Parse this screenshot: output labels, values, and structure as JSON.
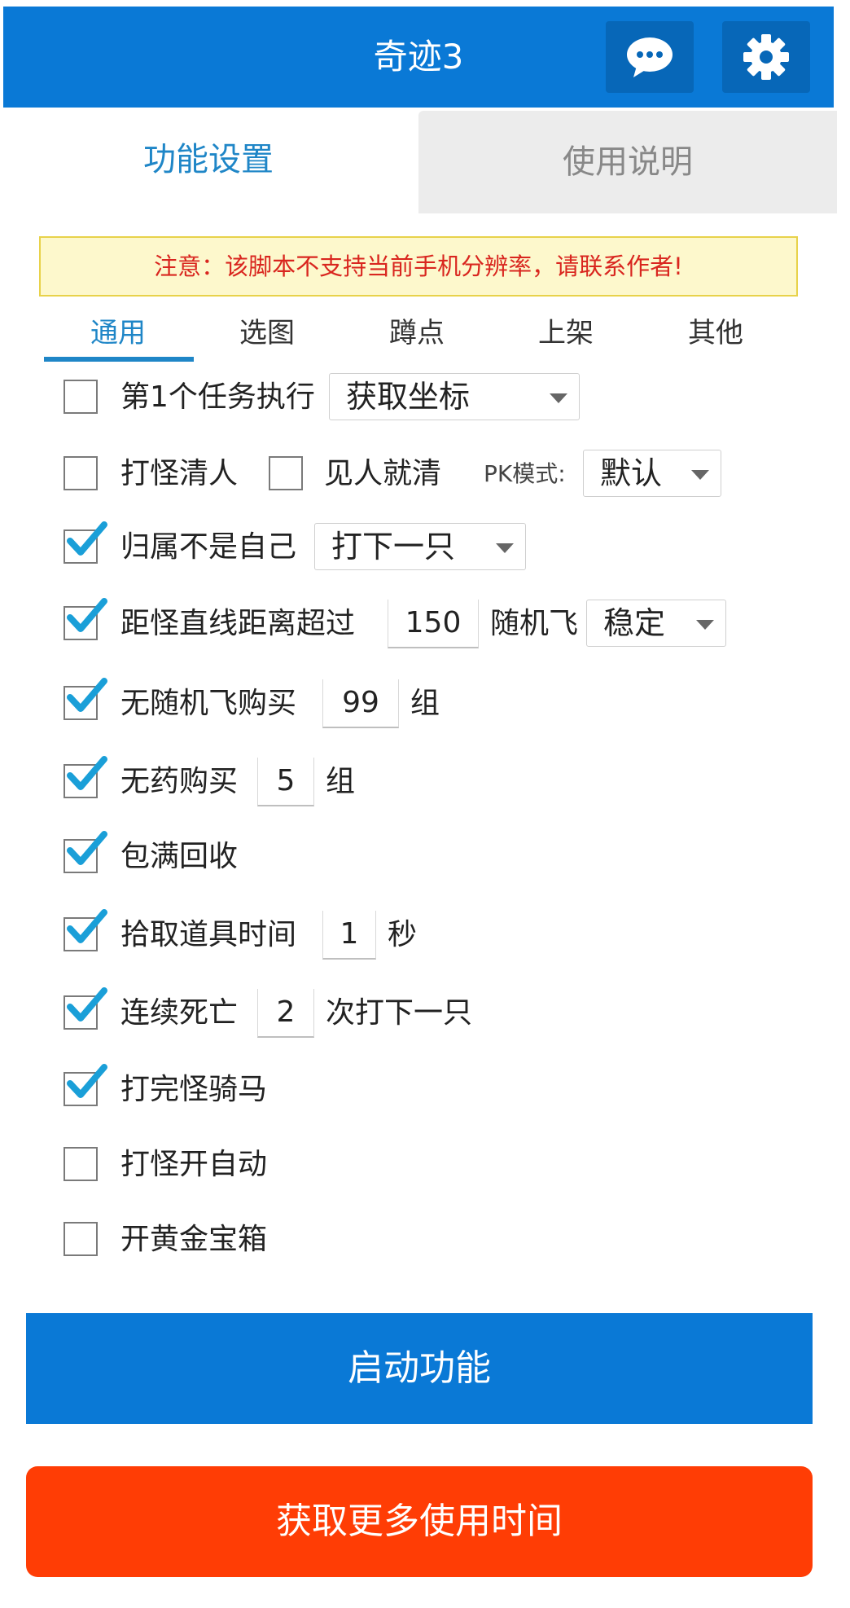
{
  "colors": {
    "primary": "#0a79d6",
    "accent_orange": "#ff3d05",
    "check": "#1a9fd8",
    "warning_text": "#d9261f"
  },
  "header": {
    "title": "奇迹3",
    "icons": [
      "chat-bubble-icon",
      "gear-icon"
    ]
  },
  "tabs": [
    {
      "label": "功能设置",
      "active": true
    },
    {
      "label": "使用说明",
      "active": false
    }
  ],
  "notice": "注意：该脚本不支持当前手机分辨率，请联系作者!",
  "subtabs": [
    {
      "label": "通用",
      "active": true
    },
    {
      "label": "选图"
    },
    {
      "label": "蹲点"
    },
    {
      "label": "上架"
    },
    {
      "label": "其他"
    }
  ],
  "rows": {
    "task": {
      "checked": false,
      "label": "第1个任务执行",
      "select": "获取坐标"
    },
    "clear": {
      "checked": false,
      "label": "打怪清人",
      "cb2_checked": false,
      "label2": "见人就清",
      "pk_label": "PK模式:",
      "pk_select": "默认"
    },
    "owner": {
      "checked": true,
      "label": "归属不是自己",
      "select": "打下一只"
    },
    "distance": {
      "checked": true,
      "label": "距怪直线距离超过",
      "value": "150",
      "label2": "随机飞",
      "select": "稳定"
    },
    "buy_fly": {
      "checked": true,
      "label": "无随机飞购买",
      "value": "99",
      "unit": "组"
    },
    "buy_potion": {
      "checked": true,
      "label": "无药购买",
      "value": "5",
      "unit": "组"
    },
    "recycle": {
      "checked": true,
      "label": "包满回收"
    },
    "pickup": {
      "checked": true,
      "label": "拾取道具时间",
      "value": "1",
      "unit": "秒"
    },
    "death": {
      "checked": true,
      "label": "连续死亡",
      "value": "2",
      "suffix": "次打下一只"
    },
    "ride": {
      "checked": true,
      "label": "打完怪骑马"
    },
    "auto": {
      "checked": false,
      "label": "打怪开自动"
    },
    "chest": {
      "checked": false,
      "label": "开黄金宝箱"
    }
  },
  "buttons": {
    "start": "启动功能",
    "more_time": "获取更多使用时间"
  }
}
